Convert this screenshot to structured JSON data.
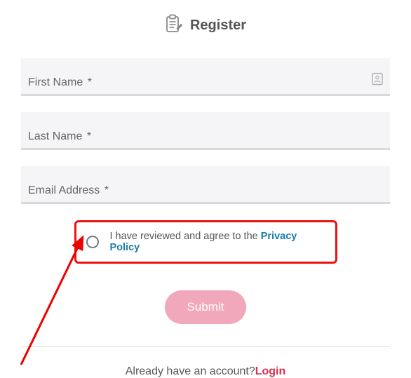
{
  "header": {
    "title": "Register",
    "icon": "clipboard-edit-icon"
  },
  "fields": {
    "first_name": {
      "label": "First Name",
      "required_mark": "*"
    },
    "last_name": {
      "label": "Last Name",
      "required_mark": "*"
    },
    "email": {
      "label": "Email Address",
      "required_mark": "*"
    }
  },
  "consent": {
    "prefix": "I have reviewed and agree to the ",
    "link_label": "Privacy Policy"
  },
  "submit_label": "Submit",
  "footer": {
    "prompt": "Already have an account?",
    "login_label": "Login"
  }
}
